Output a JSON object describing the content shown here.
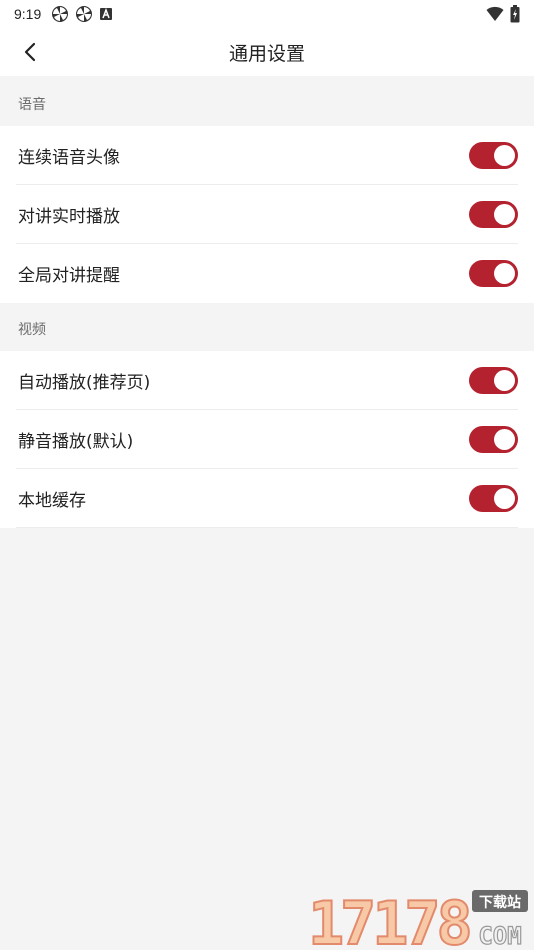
{
  "status_bar": {
    "time": "9:19",
    "notification_icons": [
      "pinwheel-icon",
      "pinwheel-icon",
      "a-badge-icon"
    ],
    "system_icons": [
      "wifi-icon",
      "battery-charging-icon"
    ]
  },
  "header": {
    "back_icon": "chevron-left-icon",
    "title": "通用设置"
  },
  "sections": [
    {
      "header": "语音",
      "items": [
        {
          "label": "连续语音头像",
          "enabled": true
        },
        {
          "label": "对讲实时播放",
          "enabled": true
        },
        {
          "label": "全局对讲提醒",
          "enabled": true
        }
      ]
    },
    {
      "header": "视频",
      "items": [
        {
          "label": "自动播放(推荐页)",
          "enabled": true
        },
        {
          "label": "静音播放(默认)",
          "enabled": true
        },
        {
          "label": "本地缓存",
          "enabled": true
        }
      ]
    }
  ],
  "colors": {
    "accent": "#b3222e",
    "background": "#f4f4f4",
    "surface": "#ffffff"
  },
  "watermark": {
    "number": "17178",
    "badge": "下载站",
    "domain": "COM"
  }
}
